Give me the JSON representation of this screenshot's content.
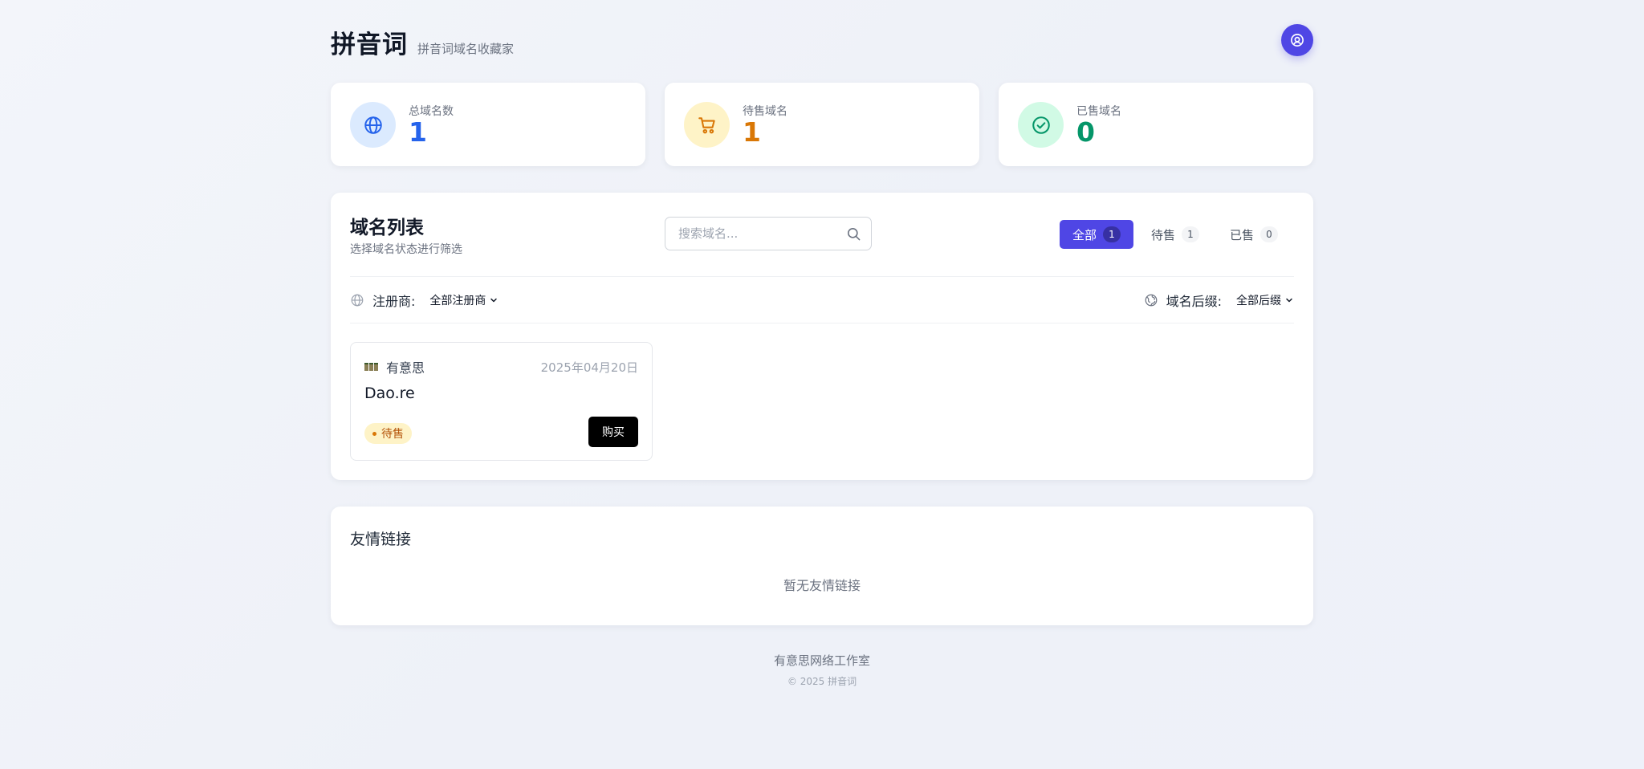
{
  "header": {
    "title": "拼音词",
    "subtitle": "拼音词域名收藏家",
    "user_icon": "user-circle-icon"
  },
  "stats": [
    {
      "label": "总域名数",
      "value": "1",
      "icon": "globe-icon",
      "color": "#2563eb",
      "bg": "#dbeafe"
    },
    {
      "label": "待售域名",
      "value": "1",
      "icon": "cart-icon",
      "color": "#d97706",
      "bg": "#fef3c7"
    },
    {
      "label": "已售域名",
      "value": "0",
      "icon": "check-circle-icon",
      "color": "#059669",
      "bg": "#d1fae5"
    }
  ],
  "domain_list": {
    "title": "域名列表",
    "subtitle": "选择域名状态进行筛选",
    "search_placeholder": "搜索域名...",
    "tabs": [
      {
        "label": "全部",
        "count": "1",
        "active": true
      },
      {
        "label": "待售",
        "count": "1",
        "active": false
      },
      {
        "label": "已售",
        "count": "0",
        "active": false
      }
    ],
    "filters": {
      "registrar_label": "注册商:",
      "registrar_value": "全部注册商",
      "suffix_label": "域名后缀:",
      "suffix_value": "全部后缀"
    },
    "items": [
      {
        "owner": "有意思",
        "date": "2025年04月20日",
        "name": "Dao.re",
        "status": "待售",
        "buy_label": "购买"
      }
    ]
  },
  "friends": {
    "title": "友情链接",
    "empty": "暂无友情链接"
  },
  "footer": {
    "org": "有意思网络工作室",
    "copyright": "© 2025 拼音词"
  },
  "colors": {
    "accent": "#4f46e5",
    "pending": "#d97706"
  }
}
